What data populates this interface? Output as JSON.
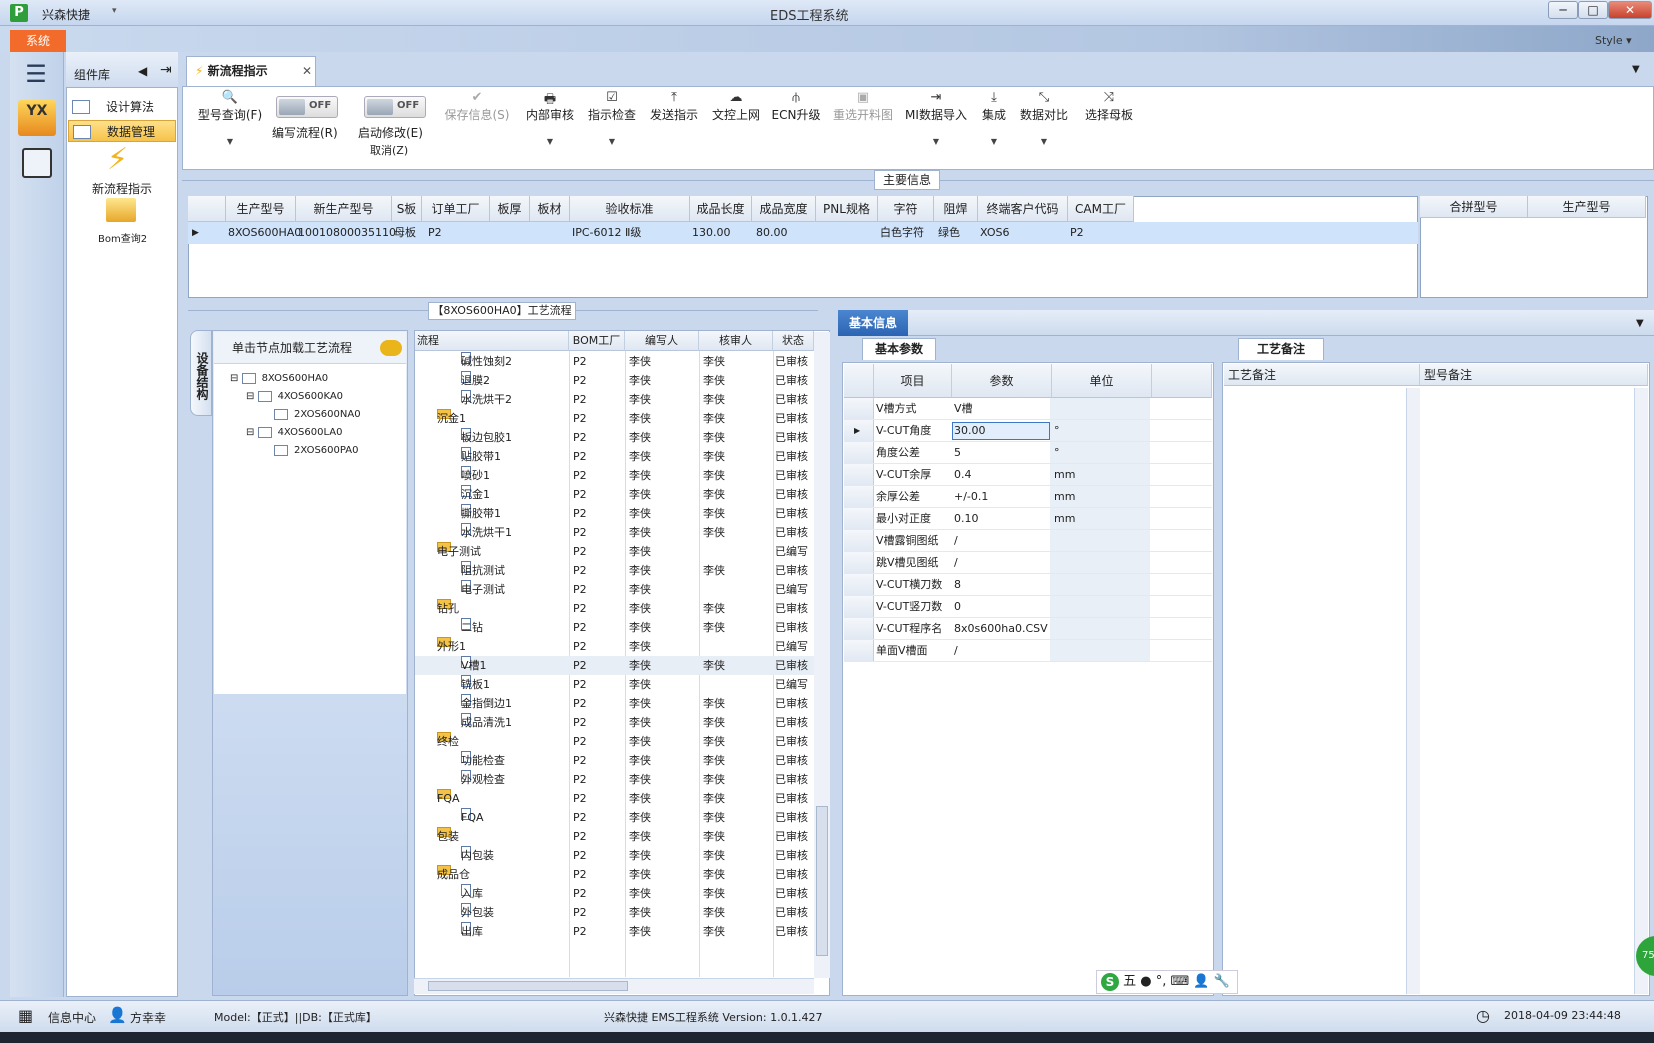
{
  "window": {
    "app_name": "兴森快捷",
    "title": "EDS工程系统",
    "minimize": "─",
    "maximize": "□",
    "close": "✕"
  },
  "menu": {
    "system": "系统",
    "style": "Style"
  },
  "nav": {
    "hamburger": "☰",
    "yx": "YX"
  },
  "component_panel": {
    "title": "组件库",
    "items": [
      {
        "label": "设计算法"
      },
      {
        "label": "数据管理"
      }
    ],
    "new_flow_label": "新流程指示",
    "bom_label": "Bom查询2"
  },
  "tab": {
    "label": "新流程指示",
    "close": "✕"
  },
  "toolbar": {
    "model_query": "型号查询(F)",
    "write_flow": "编写流程(R)",
    "start_modify": "启动修改(E)",
    "cancel": "取消(Z)",
    "toggle_off": "OFF",
    "save_info": "保存信息(S)",
    "internal_review": "内部审核",
    "instruction_check": "指示检查",
    "send_instruction": "发送指示",
    "doc_upload": "文控上网",
    "ecn_upgrade": "ECN升级",
    "reselect_drawing": "重选开料图",
    "mi_import": "MI数据导入",
    "integrate": "集成",
    "data_compare": "数据对比",
    "select_mother": "选择母板"
  },
  "main_info": {
    "label": "主要信息",
    "columns": [
      "生产型号",
      "新生产型号",
      "S板",
      "订单工厂",
      "板厚",
      "板材",
      "验收标准",
      "成品长度",
      "成品宽度",
      "PNL规格",
      "字符",
      "阻焊",
      "终端客户代码",
      "CAM工厂"
    ],
    "row": [
      "8XOS600HA0",
      "10010800035110",
      "母板",
      "P2",
      "",
      "",
      "IPC-6012 Ⅱ级",
      "130.00",
      "80.00",
      "",
      "白色字符",
      "绿色",
      "XOS6",
      "P2"
    ],
    "merge_columns": [
      "合拼型号",
      "生产型号"
    ]
  },
  "structure": {
    "side_tab": "设备结构",
    "header": "单击节点加载工艺流程",
    "nodes": [
      "8XOS600HA0",
      "4XOS600KA0",
      "2XOS600NA0",
      "4XOS600LA0",
      "2XOS600PA0"
    ]
  },
  "flow": {
    "title": "【8XOS600HA0】工艺流程",
    "columns": [
      "流程",
      "BOM工厂",
      "编写人",
      "核审人",
      "状态"
    ],
    "rows": [
      {
        "name": "碱性蚀刻2",
        "factory": "P2",
        "writer": "李侠",
        "reviewer": "李侠",
        "status": "已审核"
      },
      {
        "name": "退膜2",
        "factory": "P2",
        "writer": "李侠",
        "reviewer": "李侠",
        "status": "已审核"
      },
      {
        "name": "水洗烘干2",
        "factory": "P2",
        "writer": "李侠",
        "reviewer": "李侠",
        "status": "已审核"
      },
      {
        "name": "沉金1",
        "factory": "P2",
        "writer": "李侠",
        "reviewer": "李侠",
        "status": "已审核"
      },
      {
        "name": "板边包胶1",
        "factory": "P2",
        "writer": "李侠",
        "reviewer": "李侠",
        "status": "已审核"
      },
      {
        "name": "贴胶带1",
        "factory": "P2",
        "writer": "李侠",
        "reviewer": "李侠",
        "status": "已审核"
      },
      {
        "name": "喷砂1",
        "factory": "P2",
        "writer": "李侠",
        "reviewer": "李侠",
        "status": "已审核"
      },
      {
        "name": "沉金1",
        "factory": "P2",
        "writer": "李侠",
        "reviewer": "李侠",
        "status": "已审核"
      },
      {
        "name": "撕胶带1",
        "factory": "P2",
        "writer": "李侠",
        "reviewer": "李侠",
        "status": "已审核"
      },
      {
        "name": "水洗烘干1",
        "factory": "P2",
        "writer": "李侠",
        "reviewer": "李侠",
        "status": "已审核"
      },
      {
        "name": "电子测试",
        "factory": "P2",
        "writer": "李侠",
        "reviewer": "",
        "status": "已编写"
      },
      {
        "name": "阻抗测试",
        "factory": "P2",
        "writer": "李侠",
        "reviewer": "李侠",
        "status": "已审核"
      },
      {
        "name": "电子测试",
        "factory": "P2",
        "writer": "李侠",
        "reviewer": "",
        "status": "已编写"
      },
      {
        "name": "钻孔",
        "factory": "P2",
        "writer": "李侠",
        "reviewer": "李侠",
        "status": "已审核"
      },
      {
        "name": "二钻",
        "factory": "P2",
        "writer": "李侠",
        "reviewer": "李侠",
        "status": "已审核"
      },
      {
        "name": "外形1",
        "factory": "P2",
        "writer": "李侠",
        "reviewer": "",
        "status": "已编写"
      },
      {
        "name": "V槽1",
        "factory": "P2",
        "writer": "李侠",
        "reviewer": "李侠",
        "status": "已审核"
      },
      {
        "name": "铣板1",
        "factory": "P2",
        "writer": "李侠",
        "reviewer": "",
        "status": "已编写"
      },
      {
        "name": "金指倒边1",
        "factory": "P2",
        "writer": "李侠",
        "reviewer": "李侠",
        "status": "已审核"
      },
      {
        "name": "成品清洗1",
        "factory": "P2",
        "writer": "李侠",
        "reviewer": "李侠",
        "status": "已审核"
      },
      {
        "name": "终检",
        "factory": "P2",
        "writer": "李侠",
        "reviewer": "李侠",
        "status": "已审核"
      },
      {
        "name": "功能检查",
        "factory": "P2",
        "writer": "李侠",
        "reviewer": "李侠",
        "status": "已审核"
      },
      {
        "name": "外观检查",
        "factory": "P2",
        "writer": "李侠",
        "reviewer": "李侠",
        "status": "已审核"
      },
      {
        "name": "FQA",
        "factory": "P2",
        "writer": "李侠",
        "reviewer": "李侠",
        "status": "已审核"
      },
      {
        "name": "FQA",
        "factory": "P2",
        "writer": "李侠",
        "reviewer": "李侠",
        "status": "已审核"
      },
      {
        "name": "包装",
        "factory": "P2",
        "writer": "李侠",
        "reviewer": "李侠",
        "status": "已审核"
      },
      {
        "name": "内包装",
        "factory": "P2",
        "writer": "李侠",
        "reviewer": "李侠",
        "status": "已审核"
      },
      {
        "name": "成品仓",
        "factory": "P2",
        "writer": "李侠",
        "reviewer": "李侠",
        "status": "已审核"
      },
      {
        "name": "入库",
        "factory": "P2",
        "writer": "李侠",
        "reviewer": "李侠",
        "status": "已审核"
      },
      {
        "name": "外包装",
        "factory": "P2",
        "writer": "李侠",
        "reviewer": "李侠",
        "status": "已审核"
      },
      {
        "name": "出库",
        "factory": "P2",
        "writer": "李侠",
        "reviewer": "李侠",
        "status": "已审核"
      }
    ]
  },
  "basic_info": {
    "tab": "基本信息",
    "param_tab": "基本参数",
    "columns": [
      "项目",
      "参数",
      "单位"
    ],
    "rows": [
      {
        "item": "V槽方式",
        "value": "V槽",
        "unit": ""
      },
      {
        "item": "V-CUT角度",
        "value": "30.00",
        "unit": "°"
      },
      {
        "item": "角度公差",
        "value": "5",
        "unit": "°"
      },
      {
        "item": "V-CUT余厚",
        "value": "0.4",
        "unit": "mm"
      },
      {
        "item": "余厚公差",
        "value": "+/-0.1",
        "unit": "mm"
      },
      {
        "item": "最小对正度",
        "value": "0.10",
        "unit": "mm"
      },
      {
        "item": "V槽露铜图纸",
        "value": "/",
        "unit": ""
      },
      {
        "item": "跳V槽见图纸",
        "value": "/",
        "unit": ""
      },
      {
        "item": "V-CUT横刀数",
        "value": "8",
        "unit": ""
      },
      {
        "item": "V-CUT竖刀数",
        "value": "0",
        "unit": ""
      },
      {
        "item": "V-CUT程序名",
        "value": "8x0s600ha0.CSV",
        "unit": ""
      },
      {
        "item": "单面V槽面",
        "value": "/",
        "unit": ""
      }
    ],
    "remark_tab": "工艺备注",
    "remark_columns": [
      "工艺备注",
      "型号备注"
    ]
  },
  "ime": {
    "s": "S",
    "text": "五 ● °, ⌨ 👤 🔧"
  },
  "badge": "75",
  "status": {
    "info_center": "信息中心",
    "user": "方幸幸",
    "model": "Model:【正式】||DB:【正式库】",
    "version": "兴森快捷 EMS工程系统 Version: 1.0.1.427",
    "datetime": "2018-04-09 23:44:48"
  }
}
